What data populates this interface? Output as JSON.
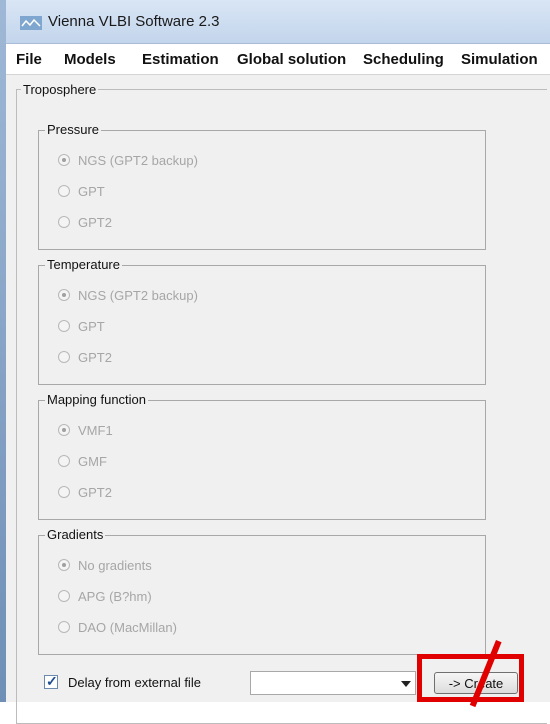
{
  "window": {
    "title": "Vienna VLBI Software 2.3"
  },
  "menu": [
    "File",
    "Models",
    "Estimation",
    "Global solution",
    "Scheduling",
    "Simulation"
  ],
  "troposphere": {
    "label": "Troposphere",
    "groups": [
      {
        "label": "Pressure",
        "options": [
          "NGS (GPT2 backup)",
          "GPT",
          "GPT2"
        ],
        "selected": 0
      },
      {
        "label": "Temperature",
        "options": [
          "NGS (GPT2 backup)",
          "GPT",
          "GPT2"
        ],
        "selected": 0
      },
      {
        "label": "Mapping function",
        "options": [
          "VMF1",
          "GMF",
          "GPT2"
        ],
        "selected": 0
      },
      {
        "label": "Gradients",
        "options": [
          "No gradients",
          "APG (B?hm)",
          "DAO (MacMillan)"
        ],
        "selected": 0
      }
    ]
  },
  "delay": {
    "label": "Delay from external file",
    "checked": true,
    "combo_value": ""
  },
  "buttons": {
    "create": "-> Create"
  },
  "colors": {
    "highlight": "#e00000",
    "disabled_text": "#a6a6a6"
  }
}
